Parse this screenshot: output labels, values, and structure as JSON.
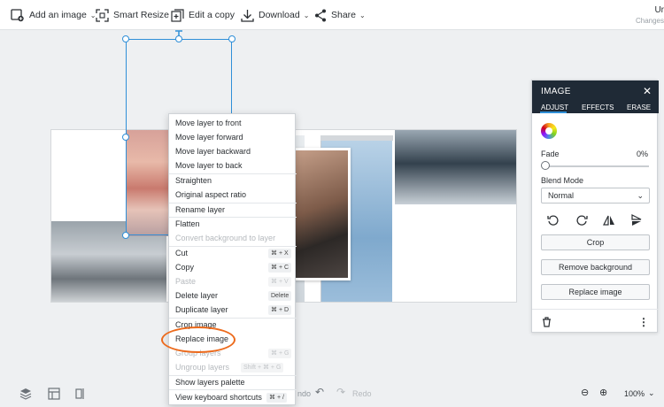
{
  "toolbar": {
    "add_image": "Add an image",
    "smart_resize": "Smart Resize",
    "edit_copy": "Edit a copy",
    "download": "Download",
    "share": "Share",
    "user_name": "Ur",
    "user_status": "Changes"
  },
  "context_menu": {
    "items": [
      {
        "label": "Move layer to front",
        "disabled": false,
        "shortcut": ""
      },
      {
        "label": "Move layer forward",
        "disabled": false,
        "shortcut": ""
      },
      {
        "label": "Move layer backward",
        "disabled": false,
        "shortcut": ""
      },
      {
        "label": "Move layer to back",
        "disabled": false,
        "shortcut": ""
      },
      {
        "label": "Straighten",
        "disabled": false,
        "shortcut": ""
      },
      {
        "label": "Original aspect ratio",
        "disabled": false,
        "shortcut": ""
      },
      {
        "label": "Rename layer",
        "disabled": false,
        "shortcut": ""
      },
      {
        "label": "Flatten",
        "disabled": false,
        "shortcut": ""
      },
      {
        "label": "Convert background to layer",
        "disabled": true,
        "shortcut": ""
      },
      {
        "label": "Cut",
        "disabled": false,
        "shortcut": "⌘ + X"
      },
      {
        "label": "Copy",
        "disabled": false,
        "shortcut": "⌘ + C"
      },
      {
        "label": "Paste",
        "disabled": true,
        "shortcut": "⌘ + V"
      },
      {
        "label": "Delete layer",
        "disabled": false,
        "shortcut": "Delete"
      },
      {
        "label": "Duplicate layer",
        "disabled": false,
        "shortcut": "⌘ + D"
      },
      {
        "label": "Crop image",
        "disabled": false,
        "shortcut": ""
      },
      {
        "label": "Replace image",
        "disabled": false,
        "shortcut": ""
      },
      {
        "label": "Group layers",
        "disabled": true,
        "shortcut": "⌘ + G"
      },
      {
        "label": "Ungroup layers",
        "disabled": true,
        "shortcut": "Shift + ⌘ + G"
      },
      {
        "label": "Show layers palette",
        "disabled": false,
        "shortcut": ""
      },
      {
        "label": "View keyboard shortcuts",
        "disabled": false,
        "shortcut": "⌘ + /"
      }
    ]
  },
  "panel": {
    "title": "IMAGE",
    "tabs": [
      "ADJUST",
      "EFFECTS",
      "ERASE"
    ],
    "active_tab": "ADJUST",
    "fade_label": "Fade",
    "fade_value": "0%",
    "fade_level": 0,
    "blend_label": "Blend Mode",
    "blend_value": "Normal",
    "crop": "Crop",
    "remove_background": "Remove background",
    "replace_image": "Replace image"
  },
  "bottom": {
    "undo": "ndo",
    "redo": "Redo",
    "zoom": "100%"
  },
  "colors": {
    "accent": "#2f8fd8",
    "highlight": "#ec6a1c",
    "panel_header": "#1f2a36"
  }
}
